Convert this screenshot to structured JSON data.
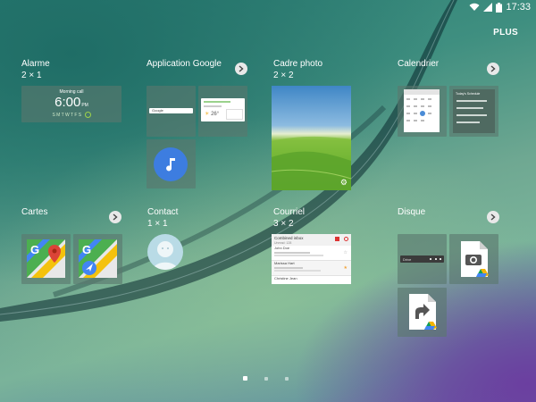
{
  "status_bar": {
    "time": "17:33"
  },
  "header": {
    "plus_label": "PLUS"
  },
  "widgets": {
    "alarme": {
      "title": "Alarme",
      "size": "2 × 1",
      "label": "Morning call",
      "time": "6:00",
      "ampm": "PM",
      "days": "S M T W T F S"
    },
    "app_google": {
      "title": "Application Google",
      "search_hint": "Google",
      "weather": "26°"
    },
    "cadre_photo": {
      "title": "Cadre photo",
      "size": "2 × 2"
    },
    "calendrier": {
      "title": "Calendrier",
      "agenda_title": "Today's Schedule"
    },
    "cartes": {
      "title": "Cartes"
    },
    "contact": {
      "title": "Contact",
      "size": "1 × 1"
    },
    "courriel": {
      "title": "Courriel",
      "size": "3 × 2",
      "inbox": "Combined inbox",
      "unread": "Unread: 128",
      "rows": [
        "John Doe",
        "Marissa Hart",
        "Christine Jean"
      ]
    },
    "disque": {
      "title": "Disque",
      "drive_label": "Drive"
    }
  },
  "pager": {
    "pages": 3,
    "active": 0
  },
  "colors": {
    "tile_bg": "#5a786e",
    "accent_green": "#4caf50",
    "music_blue": "#3d7de0"
  }
}
